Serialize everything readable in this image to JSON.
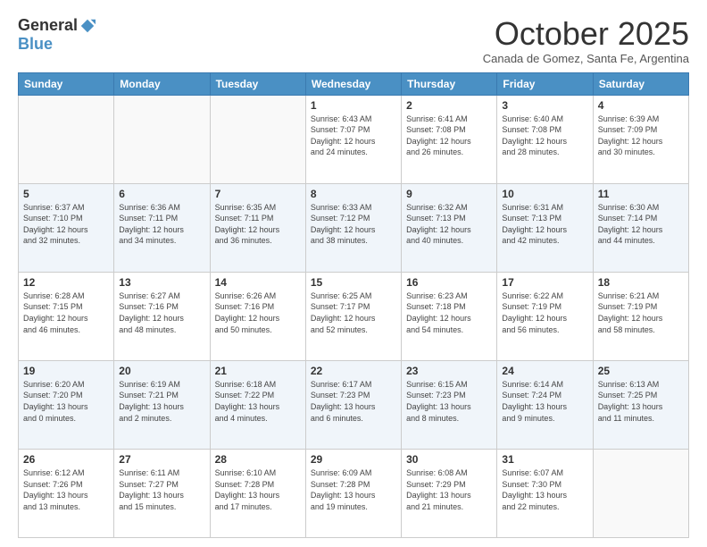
{
  "logo": {
    "general": "General",
    "blue": "Blue"
  },
  "header": {
    "month": "October 2025",
    "subtitle": "Canada de Gomez, Santa Fe, Argentina"
  },
  "weekdays": [
    "Sunday",
    "Monday",
    "Tuesday",
    "Wednesday",
    "Thursday",
    "Friday",
    "Saturday"
  ],
  "weeks": [
    [
      {
        "day": "",
        "info": ""
      },
      {
        "day": "",
        "info": ""
      },
      {
        "day": "",
        "info": ""
      },
      {
        "day": "1",
        "info": "Sunrise: 6:43 AM\nSunset: 7:07 PM\nDaylight: 12 hours\nand 24 minutes."
      },
      {
        "day": "2",
        "info": "Sunrise: 6:41 AM\nSunset: 7:08 PM\nDaylight: 12 hours\nand 26 minutes."
      },
      {
        "day": "3",
        "info": "Sunrise: 6:40 AM\nSunset: 7:08 PM\nDaylight: 12 hours\nand 28 minutes."
      },
      {
        "day": "4",
        "info": "Sunrise: 6:39 AM\nSunset: 7:09 PM\nDaylight: 12 hours\nand 30 minutes."
      }
    ],
    [
      {
        "day": "5",
        "info": "Sunrise: 6:37 AM\nSunset: 7:10 PM\nDaylight: 12 hours\nand 32 minutes."
      },
      {
        "day": "6",
        "info": "Sunrise: 6:36 AM\nSunset: 7:11 PM\nDaylight: 12 hours\nand 34 minutes."
      },
      {
        "day": "7",
        "info": "Sunrise: 6:35 AM\nSunset: 7:11 PM\nDaylight: 12 hours\nand 36 minutes."
      },
      {
        "day": "8",
        "info": "Sunrise: 6:33 AM\nSunset: 7:12 PM\nDaylight: 12 hours\nand 38 minutes."
      },
      {
        "day": "9",
        "info": "Sunrise: 6:32 AM\nSunset: 7:13 PM\nDaylight: 12 hours\nand 40 minutes."
      },
      {
        "day": "10",
        "info": "Sunrise: 6:31 AM\nSunset: 7:13 PM\nDaylight: 12 hours\nand 42 minutes."
      },
      {
        "day": "11",
        "info": "Sunrise: 6:30 AM\nSunset: 7:14 PM\nDaylight: 12 hours\nand 44 minutes."
      }
    ],
    [
      {
        "day": "12",
        "info": "Sunrise: 6:28 AM\nSunset: 7:15 PM\nDaylight: 12 hours\nand 46 minutes."
      },
      {
        "day": "13",
        "info": "Sunrise: 6:27 AM\nSunset: 7:16 PM\nDaylight: 12 hours\nand 48 minutes."
      },
      {
        "day": "14",
        "info": "Sunrise: 6:26 AM\nSunset: 7:16 PM\nDaylight: 12 hours\nand 50 minutes."
      },
      {
        "day": "15",
        "info": "Sunrise: 6:25 AM\nSunset: 7:17 PM\nDaylight: 12 hours\nand 52 minutes."
      },
      {
        "day": "16",
        "info": "Sunrise: 6:23 AM\nSunset: 7:18 PM\nDaylight: 12 hours\nand 54 minutes."
      },
      {
        "day": "17",
        "info": "Sunrise: 6:22 AM\nSunset: 7:19 PM\nDaylight: 12 hours\nand 56 minutes."
      },
      {
        "day": "18",
        "info": "Sunrise: 6:21 AM\nSunset: 7:19 PM\nDaylight: 12 hours\nand 58 minutes."
      }
    ],
    [
      {
        "day": "19",
        "info": "Sunrise: 6:20 AM\nSunset: 7:20 PM\nDaylight: 13 hours\nand 0 minutes."
      },
      {
        "day": "20",
        "info": "Sunrise: 6:19 AM\nSunset: 7:21 PM\nDaylight: 13 hours\nand 2 minutes."
      },
      {
        "day": "21",
        "info": "Sunrise: 6:18 AM\nSunset: 7:22 PM\nDaylight: 13 hours\nand 4 minutes."
      },
      {
        "day": "22",
        "info": "Sunrise: 6:17 AM\nSunset: 7:23 PM\nDaylight: 13 hours\nand 6 minutes."
      },
      {
        "day": "23",
        "info": "Sunrise: 6:15 AM\nSunset: 7:23 PM\nDaylight: 13 hours\nand 8 minutes."
      },
      {
        "day": "24",
        "info": "Sunrise: 6:14 AM\nSunset: 7:24 PM\nDaylight: 13 hours\nand 9 minutes."
      },
      {
        "day": "25",
        "info": "Sunrise: 6:13 AM\nSunset: 7:25 PM\nDaylight: 13 hours\nand 11 minutes."
      }
    ],
    [
      {
        "day": "26",
        "info": "Sunrise: 6:12 AM\nSunset: 7:26 PM\nDaylight: 13 hours\nand 13 minutes."
      },
      {
        "day": "27",
        "info": "Sunrise: 6:11 AM\nSunset: 7:27 PM\nDaylight: 13 hours\nand 15 minutes."
      },
      {
        "day": "28",
        "info": "Sunrise: 6:10 AM\nSunset: 7:28 PM\nDaylight: 13 hours\nand 17 minutes."
      },
      {
        "day": "29",
        "info": "Sunrise: 6:09 AM\nSunset: 7:28 PM\nDaylight: 13 hours\nand 19 minutes."
      },
      {
        "day": "30",
        "info": "Sunrise: 6:08 AM\nSunset: 7:29 PM\nDaylight: 13 hours\nand 21 minutes."
      },
      {
        "day": "31",
        "info": "Sunrise: 6:07 AM\nSunset: 7:30 PM\nDaylight: 13 hours\nand 22 minutes."
      },
      {
        "day": "",
        "info": ""
      }
    ]
  ]
}
